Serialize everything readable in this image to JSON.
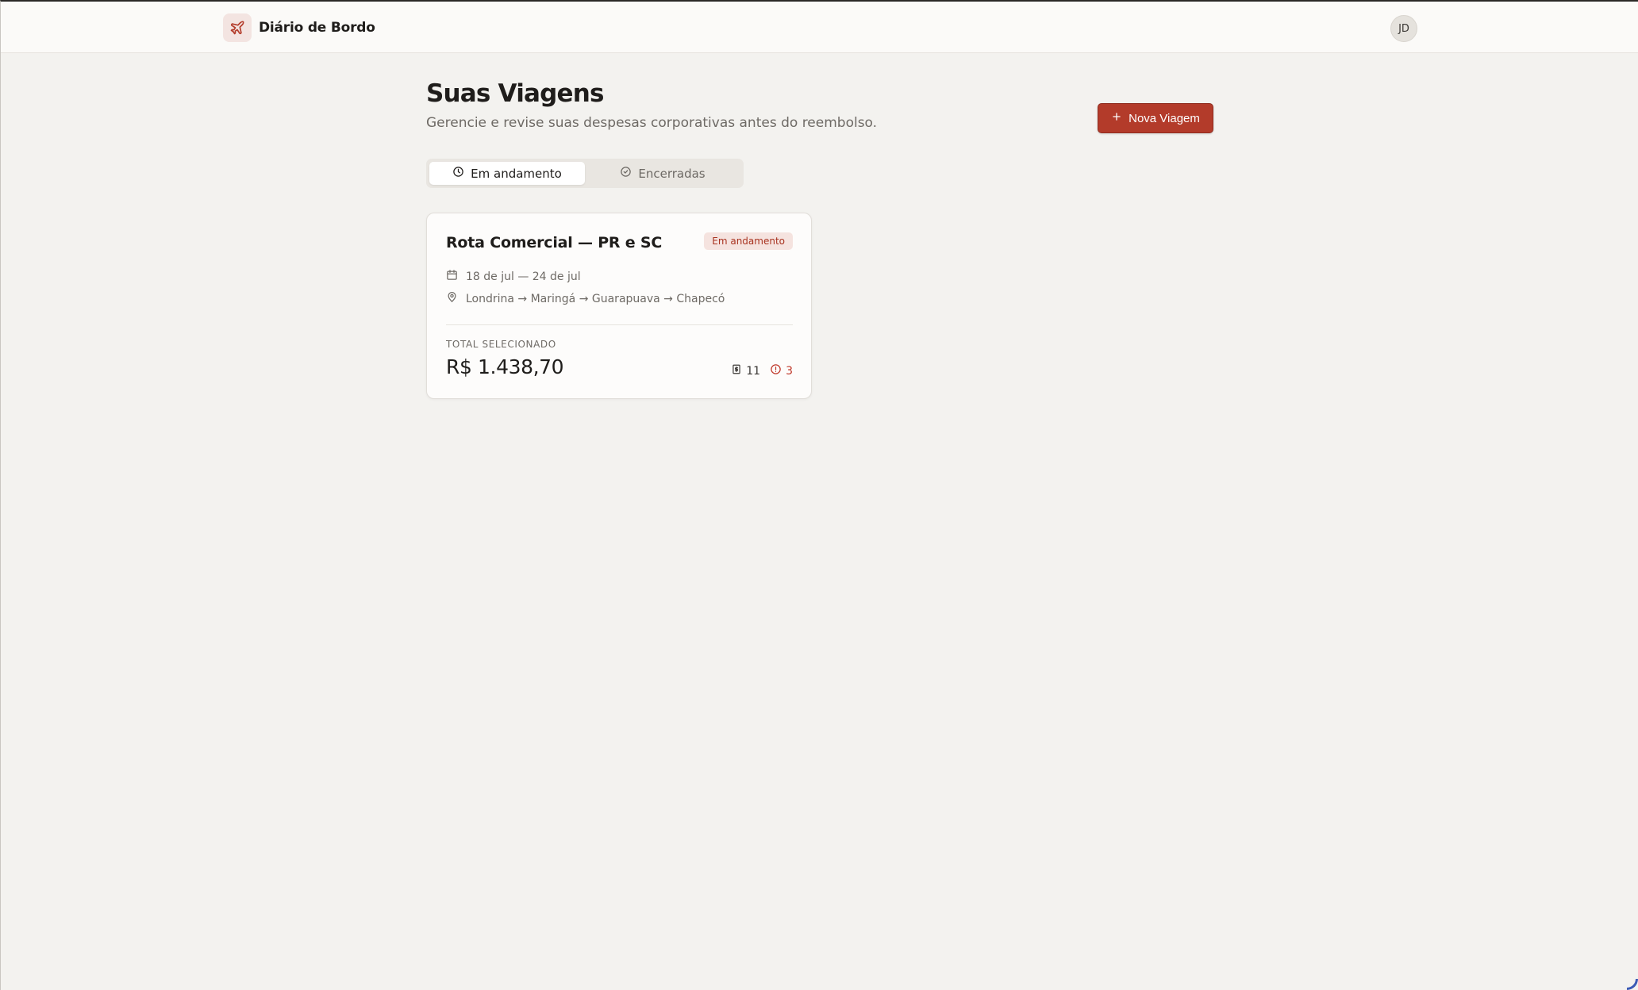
{
  "app": {
    "name": "Diário de Bordo",
    "logo_icon": "plane-icon"
  },
  "user": {
    "initials": "JD"
  },
  "page": {
    "title": "Suas Viagens",
    "subtitle": "Gerencie e revise suas despesas corporativas antes do reembolso."
  },
  "actions": {
    "new_trip_label": "Nova Viagem",
    "new_trip_icon": "plus-icon"
  },
  "tabs": [
    {
      "label": "Em andamento",
      "icon": "clock-icon",
      "active": true
    },
    {
      "label": "Encerradas",
      "icon": "check-circle-icon",
      "active": false
    }
  ],
  "trips": [
    {
      "title": "Rota Comercial — PR e SC",
      "status": "Em andamento",
      "dates": "18 de jul — 24 de jul",
      "route": "Londrina → Maringá → Guarapuava → Chapecó",
      "total_label": "TOTAL SELECIONADO",
      "total_value": "R$ 1.438,70",
      "receipts_count": "11",
      "alerts_count": "3"
    }
  ],
  "colors": {
    "accent": "#b33b2a",
    "background": "#f3f2ef",
    "badge_bg": "#f5e3df",
    "alert": "#c0392b"
  }
}
